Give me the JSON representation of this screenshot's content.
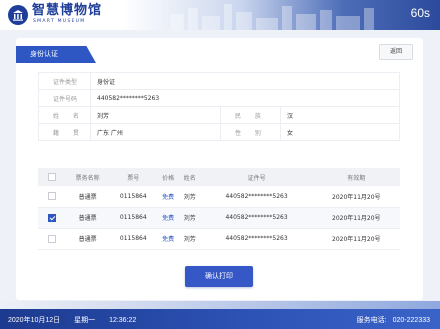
{
  "header": {
    "logo_title": "智慧博物馆",
    "logo_subtitle": "SMART MUSEUM",
    "timer": "60s"
  },
  "section": {
    "title": "身份认证",
    "back_label": "返回"
  },
  "identity": {
    "doc_type_label": "证件类型",
    "doc_type_value": "身份证",
    "doc_no_label": "证件号码",
    "doc_no_value": "440582********5263",
    "name_label": "姓 名",
    "name_value": "刘芳",
    "ethnicity_label": "民 族",
    "ethnicity_value": "汉",
    "origin_label": "籍 贯",
    "origin_value": "广东 广州",
    "gender_label": "性 别",
    "gender_value": "女"
  },
  "tickets": {
    "columns": [
      "票务名称",
      "票号",
      "价格",
      "姓名",
      "证件号",
      "有效期"
    ],
    "rows": [
      {
        "checked": false,
        "name": "普通票",
        "ticket_no": "0115864",
        "price": "免费",
        "holder": "刘芳",
        "id_no": "440582********5263",
        "valid": "2020年11月20号"
      },
      {
        "checked": true,
        "name": "普通票",
        "ticket_no": "0115864",
        "price": "免费",
        "holder": "刘芳",
        "id_no": "440582********5263",
        "valid": "2020年11月20号"
      },
      {
        "checked": false,
        "name": "普通票",
        "ticket_no": "0115864",
        "price": "免费",
        "holder": "刘芳",
        "id_no": "440582********5263",
        "valid": "2020年11月20号"
      }
    ]
  },
  "confirm_label": "确认打印",
  "footer": {
    "date": "2020年10月12日",
    "weekday": "星期一",
    "time": "12:36:22",
    "phone_label": "服务电话:",
    "phone": "020-222333"
  },
  "colors": {
    "accent": "#2f57c4",
    "footer": "#1c3a8f"
  }
}
